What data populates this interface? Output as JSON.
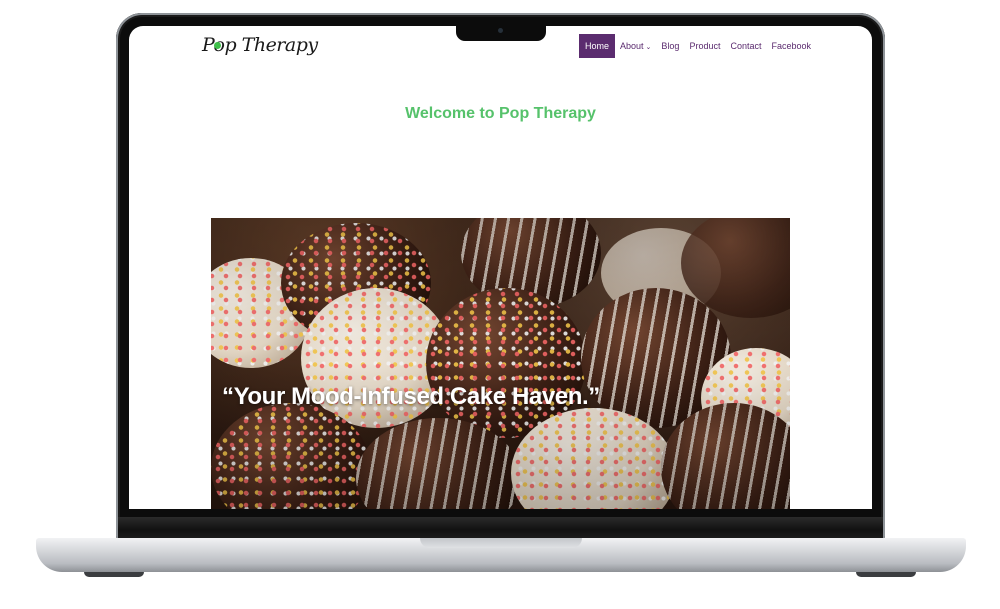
{
  "site": {
    "logo_text": "Pop Therapy"
  },
  "nav": {
    "items": [
      {
        "label": "Home",
        "active": true
      },
      {
        "label": "About",
        "has_dropdown": true
      },
      {
        "label": "Blog"
      },
      {
        "label": "Product"
      },
      {
        "label": "Contact"
      },
      {
        "label": "Facebook"
      }
    ]
  },
  "main": {
    "heading": "Welcome to Pop Therapy",
    "hero_quote": "“Your Mood-Infused Cake Haven.”"
  },
  "colors": {
    "nav_active_bg": "#5b2c6f",
    "nav_text": "#5a2a6e",
    "heading": "#56c26b"
  }
}
